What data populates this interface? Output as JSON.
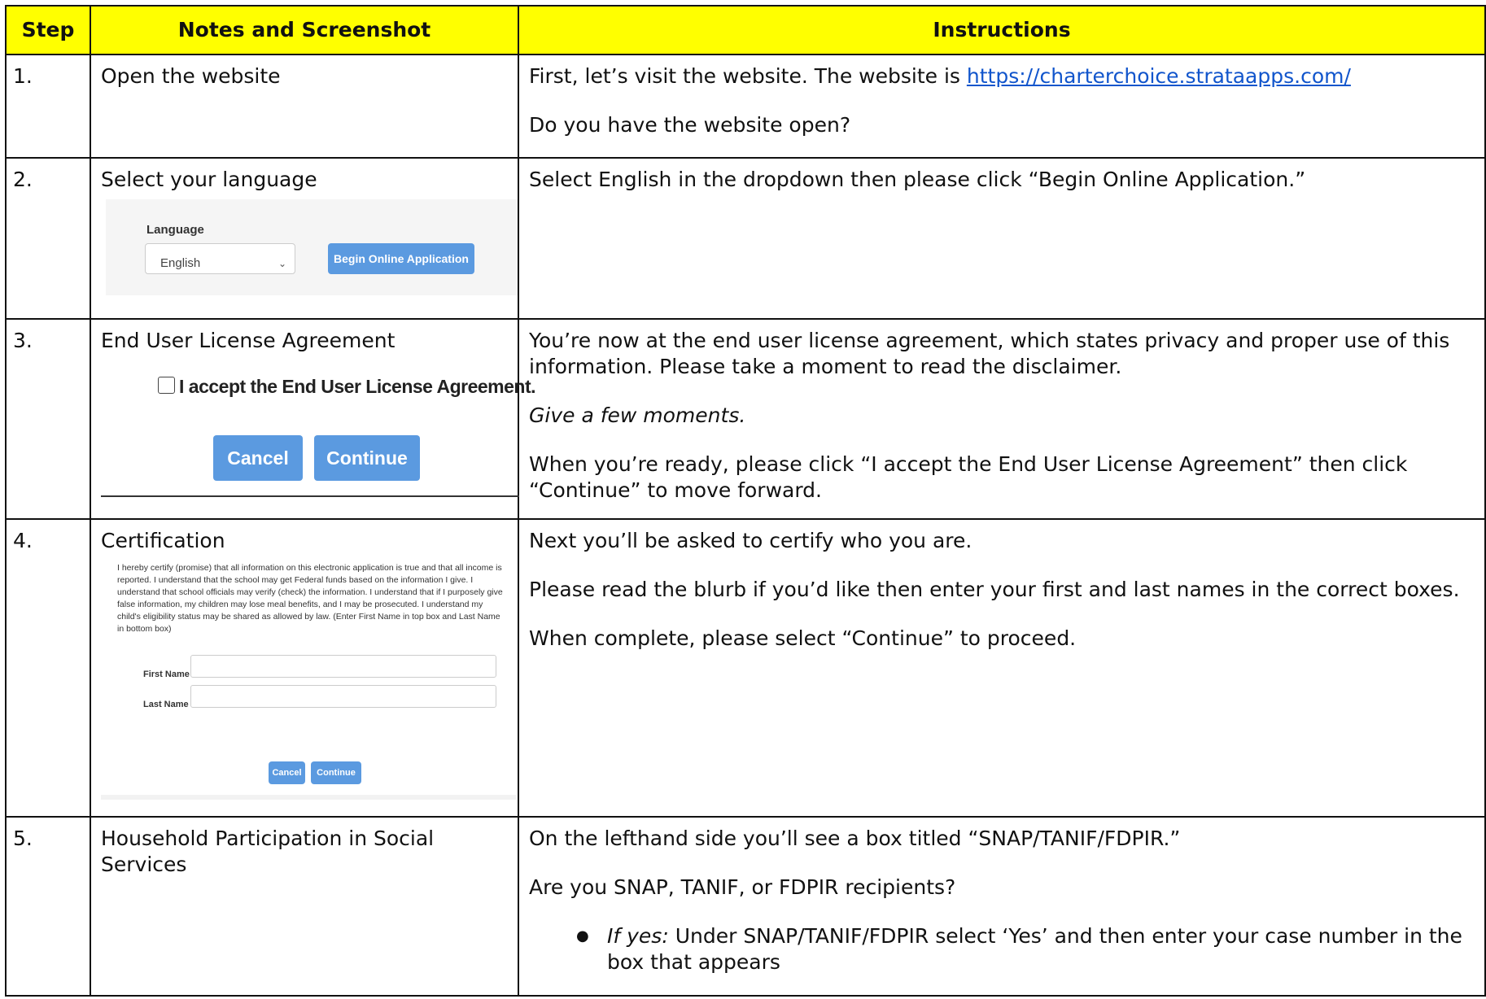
{
  "header": {
    "step": "Step",
    "notes": "Notes and Screenshot",
    "instructions": "Instructions"
  },
  "rows": [
    {
      "step": "1.",
      "note": "Open the website",
      "instr_a": "First, let’s visit the website. The website is ",
      "link": "https://charterchoice.strataapps.com/",
      "instr_b": "Do you have the website open?"
    },
    {
      "step": "2.",
      "note": "Select your language",
      "shot": {
        "label": "Language",
        "select_value": "English",
        "chevron_icon": "chevron-down-icon",
        "button": "Begin Online Application"
      },
      "instr_a": "Select English in the dropdown then please click “Begin Online Application.”"
    },
    {
      "step": "3.",
      "note": "End User License Agreement",
      "shot": {
        "checkbox_label": "I accept the End User License Agreement.",
        "cancel": "Cancel",
        "continue": "Continue"
      },
      "instr_a": "You’re now at the end user license agreement, which states privacy and proper use of this information. Please take a moment to read the disclaimer.",
      "instr_b": "Give a few moments.",
      "instr_c": "When you’re ready, please click “I accept the End User License Agreement” then click “Continue” to move forward."
    },
    {
      "step": "4.",
      "note": "Certification",
      "shot": {
        "blurb": "I hereby certify (promise) that all information on this electronic application is true and that all income is reported. I understand that the school may get Federal funds based on the information I give. I understand that school officials may verify (check) the information. I understand that if I purposely give false information, my children may lose meal benefits, and I may be prosecuted. I understand my child's eligibility status may be shared as allowed by law. (Enter First Name in top box and Last Name in bottom box)",
        "first_name": "First Name",
        "last_name": "Last Name",
        "cancel": "Cancel",
        "continue": "Continue"
      },
      "instr_a": "Next you’ll be asked to certify who you are.",
      "instr_b": "Please read the blurb if you’d like then enter your first and last names in the correct boxes.",
      "instr_c": "When complete, please select “Continue” to proceed."
    },
    {
      "step": "5.",
      "note": "Household Participation in Social Services",
      "instr_a": "On the lefthand side you’ll see a box titled “SNAP/TANIF/FDPIR.”",
      "instr_b": "Are you SNAP, TANIF, or FDPIR recipients?",
      "bullet_em": "If yes:",
      "bullet_text": " Under SNAP/TANIF/FDPIR select ‘Yes’ and then enter your case number in the box that appears"
    }
  ]
}
